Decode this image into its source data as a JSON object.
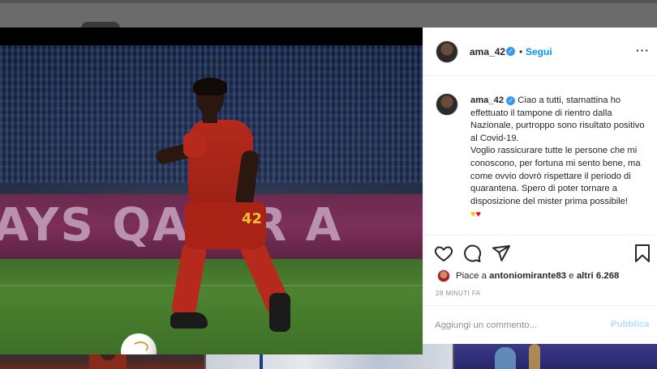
{
  "post": {
    "username": "ama_42",
    "separator": "•",
    "follow_label": "Segui",
    "more_label": "···",
    "caption": {
      "username": "ama_42",
      "lines": [
        "Ciao a tutti, stamattina ho effettuato il tampone di rientro dalla Nazionale, purtroppo sono risultato positivo al Covid-19.",
        "Voglio rassicurare tutte le persone che mi conoscono, per fortuna mi sento bene, ma come ovvio dovrò rispettare il periodo di quarantena. Spero di poter tornare a disposizione del mister prima possibile!"
      ],
      "emoji": [
        "♥",
        "♥"
      ]
    },
    "likes": {
      "prefix": "Piace a",
      "liker": "antoniomirante83",
      "conjunction": "e",
      "others": "altri 6.268"
    },
    "time": "28 MINUTI FA",
    "comment": {
      "placeholder": "Aggiungi un commento...",
      "publish_label": "Pubblica"
    },
    "icons": {
      "like": "heart-icon",
      "comment": "comment-bubble-icon",
      "share": "paper-plane-icon",
      "save": "bookmark-icon",
      "verified": "verified-badge-icon"
    },
    "verified_glyph": "✓"
  },
  "photo": {
    "ad_text": "AYS QATAR A",
    "shirt_number": "42"
  },
  "colors": {
    "accent": "#0095f6",
    "verified": "#3897f0",
    "publish_disabled": "#b2dffc",
    "text": "#262626",
    "muted": "#8e8e8e"
  }
}
